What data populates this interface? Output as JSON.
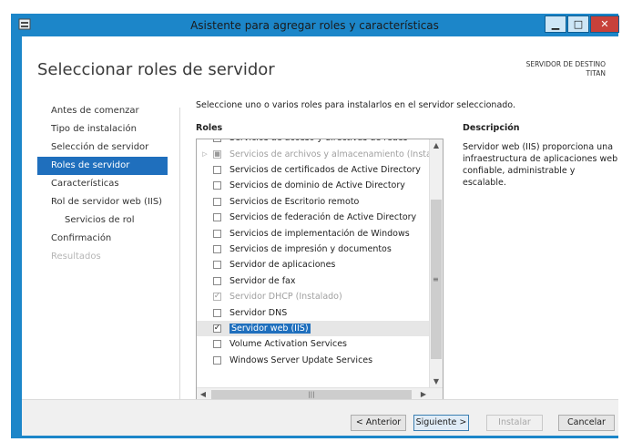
{
  "window": {
    "title": "Asistente para agregar roles y características",
    "controls": {
      "minimize": "▁",
      "maximize": "□",
      "close": "✕"
    }
  },
  "page": {
    "heading": "Seleccionar roles de servidor",
    "target_label": "SERVIDOR DE DESTINO",
    "target_name": "TITAN",
    "intro": "Seleccione uno o varios roles para instalarlos en el servidor seleccionado.",
    "roles_label": "Roles",
    "description_title": "Descripción",
    "description_text": "Servidor web (IIS) proporciona una infraestructura de aplicaciones web confiable, administrable y escalable."
  },
  "nav": [
    {
      "label": "Antes de comenzar",
      "state": "normal"
    },
    {
      "label": "Tipo de instalación",
      "state": "normal"
    },
    {
      "label": "Selección de servidor",
      "state": "normal"
    },
    {
      "label": "Roles de servidor",
      "state": "active"
    },
    {
      "label": "Características",
      "state": "normal"
    },
    {
      "label": "Rol de servidor web (IIS)",
      "state": "normal"
    },
    {
      "label": "Servicios de rol",
      "state": "sub"
    },
    {
      "label": "Confirmación",
      "state": "normal"
    },
    {
      "label": "Resultados",
      "state": "disabled"
    }
  ],
  "roles": [
    {
      "label": "Servicios de acceso y directivas de redes",
      "checked": false,
      "disabled": false,
      "expandable": false
    },
    {
      "label": "Servicios de archivos y almacenamiento (Instalado)",
      "checked": true,
      "disabled": true,
      "expandable": true
    },
    {
      "label": "Servicios de certificados de Active Directory",
      "checked": false,
      "disabled": false,
      "expandable": false
    },
    {
      "label": "Servicios de dominio de Active Directory",
      "checked": false,
      "disabled": false,
      "expandable": false
    },
    {
      "label": "Servicios de Escritorio remoto",
      "checked": false,
      "disabled": false,
      "expandable": false
    },
    {
      "label": "Servicios de federación de Active Directory",
      "checked": false,
      "disabled": false,
      "expandable": false
    },
    {
      "label": "Servicios de implementación de Windows",
      "checked": false,
      "disabled": false,
      "expandable": false
    },
    {
      "label": "Servicios de impresión y documentos",
      "checked": false,
      "disabled": false,
      "expandable": false
    },
    {
      "label": "Servidor de aplicaciones",
      "checked": false,
      "disabled": false,
      "expandable": false
    },
    {
      "label": "Servidor de fax",
      "checked": false,
      "disabled": false,
      "expandable": false
    },
    {
      "label": "Servidor DHCP (Instalado)",
      "checked": true,
      "disabled": true,
      "expandable": false
    },
    {
      "label": "Servidor DNS",
      "checked": false,
      "disabled": false,
      "expandable": false
    },
    {
      "label": "Servidor web (IIS)",
      "checked": true,
      "disabled": false,
      "expandable": false,
      "selected": true
    },
    {
      "label": "Volume Activation Services",
      "checked": false,
      "disabled": false,
      "expandable": false
    },
    {
      "label": "Windows Server Update Services",
      "checked": false,
      "disabled": false,
      "expandable": false
    }
  ],
  "buttons": {
    "back": "< Anterior",
    "next": "Siguiente >",
    "install": "Instalar",
    "cancel": "Cancelar"
  },
  "colors": {
    "window_frame": "#1c86c9",
    "selection": "#1f6fbd",
    "close_button": "#c7413a"
  }
}
